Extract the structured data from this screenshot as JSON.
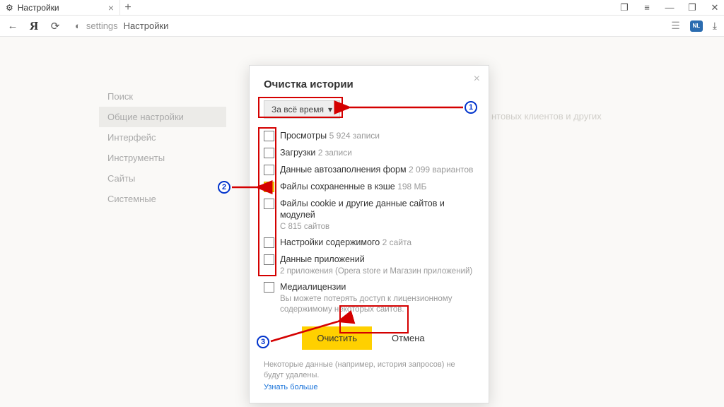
{
  "window": {
    "tab_title": "Настройки",
    "new_tab": "+",
    "controls": {
      "panels": "❐",
      "menu": "≡",
      "min": "—",
      "max": "❐",
      "close": "✕"
    }
  },
  "toolbar": {
    "back": "←",
    "ya": "Я",
    "reload": "⟳",
    "lock": "◐",
    "addr_seg1": "settings",
    "addr_seg2": "Настройки",
    "bookmark": "☰",
    "ext": "NL",
    "download": "⤓"
  },
  "sidebar": {
    "items": [
      {
        "label": "Поиск"
      },
      {
        "label": "Общие настройки"
      },
      {
        "label": "Интерфейс"
      },
      {
        "label": "Инструменты"
      },
      {
        "label": "Сайты"
      },
      {
        "label": "Системные"
      }
    ]
  },
  "bg_fragment": "нтовых клиентов и других",
  "dialog": {
    "title": "Очистка истории",
    "time_range": "За всё время",
    "items": [
      {
        "label": "Просмотры",
        "meta": "5 924 записи",
        "checked": false
      },
      {
        "label": "Загрузки",
        "meta": "2 записи",
        "checked": false
      },
      {
        "label": "Данные автозаполнения форм",
        "meta": "2 099 вариантов",
        "checked": false
      },
      {
        "label": "Файлы сохраненные в кэше",
        "meta": "198 МБ",
        "checked": true
      },
      {
        "label": "Файлы cookie и другие данные сайтов и модулей",
        "sub": "С 815 сайтов",
        "checked": false
      },
      {
        "label": "Настройки содержимого",
        "meta": "2 сайта",
        "checked": false
      },
      {
        "label": "Данные приложений",
        "sub": "2 приложения (Opera store и Магазин приложений)",
        "checked": false
      },
      {
        "label": "Медиалицензии",
        "sub": "Вы можете потерять доступ к лицензионному содержимому некоторых сайтов.",
        "checked": false
      }
    ],
    "primary": "Очистить",
    "secondary": "Отмена",
    "footer": "Некоторые данные (например, история запросов) не будут удалены.",
    "link": "Узнать больше"
  },
  "annotations": {
    "n1": "1",
    "n2": "2",
    "n3": "3"
  }
}
